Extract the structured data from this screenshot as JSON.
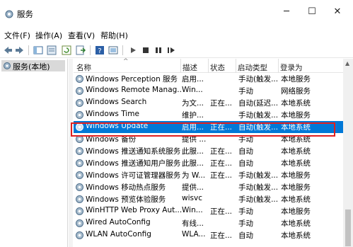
{
  "window": {
    "title": "服务"
  },
  "menu": [
    {
      "label": "文件(F)"
    },
    {
      "label": "操作(A)"
    },
    {
      "label": "查看(V)"
    },
    {
      "label": "帮助(H)"
    }
  ],
  "tree": {
    "item_label": "服务(本地)"
  },
  "columns": {
    "name": "名称",
    "description": "描述",
    "status": "状态",
    "startup": "启动类型",
    "logon": "登录为"
  },
  "rows": [
    {
      "name": "Windows Perception 服务",
      "description": "启用...",
      "status": "",
      "startup": "手动(触发...",
      "logon": "本地服务"
    },
    {
      "name": "Windows Remote Manag...",
      "description": "Win...",
      "status": "",
      "startup": "手动",
      "logon": "网络服务"
    },
    {
      "name": "Windows Search",
      "description": "为文...",
      "status": "正在...",
      "startup": "自动(延迟...",
      "logon": "本地系统"
    },
    {
      "name": "Windows Time",
      "description": "维护...",
      "status": "",
      "startup": "手动(触发...",
      "logon": "本地服务"
    },
    {
      "name": "Windows Update",
      "description": "启用...",
      "status": "正在...",
      "startup": "自动(触发...",
      "logon": "本地系统",
      "selected": true
    },
    {
      "name": "Windows 备份",
      "description": "提供 ...",
      "status": "",
      "startup": "手动",
      "logon": "本地系统"
    },
    {
      "name": "Windows 推送通知系统服务",
      "description": "此服...",
      "status": "正在...",
      "startup": "自动",
      "logon": "本地系统"
    },
    {
      "name": "Windows 推送通知用户服务",
      "description": "此服...",
      "status": "正在...",
      "startup": "自动",
      "logon": "本地系统"
    },
    {
      "name": "Windows 许可证管理器服务",
      "description": "为 W...",
      "status": "正在...",
      "startup": "手动(触发...",
      "logon": "本地服务"
    },
    {
      "name": "Windows 移动热点服务",
      "description": "提供...",
      "status": "",
      "startup": "手动(触发...",
      "logon": "本地服务"
    },
    {
      "name": "Windows 预览体验服务",
      "description": "wisvc",
      "status": "",
      "startup": "手动(触发...",
      "logon": "本地系统"
    },
    {
      "name": "WinHTTP Web Proxy Aut...",
      "description": "Win...",
      "status": "正在...",
      "startup": "手动",
      "logon": "本地服务"
    },
    {
      "name": "Wired AutoConfig",
      "description": "有线...",
      "status": "",
      "startup": "手动",
      "logon": "本地系统"
    },
    {
      "name": "WLAN AutoConfig",
      "description": "WLA...",
      "status": "正在...",
      "startup": "自动",
      "logon": "本地系统"
    }
  ],
  "colors": {
    "selection": "#0078d7",
    "highlight_box": "#e02020"
  }
}
